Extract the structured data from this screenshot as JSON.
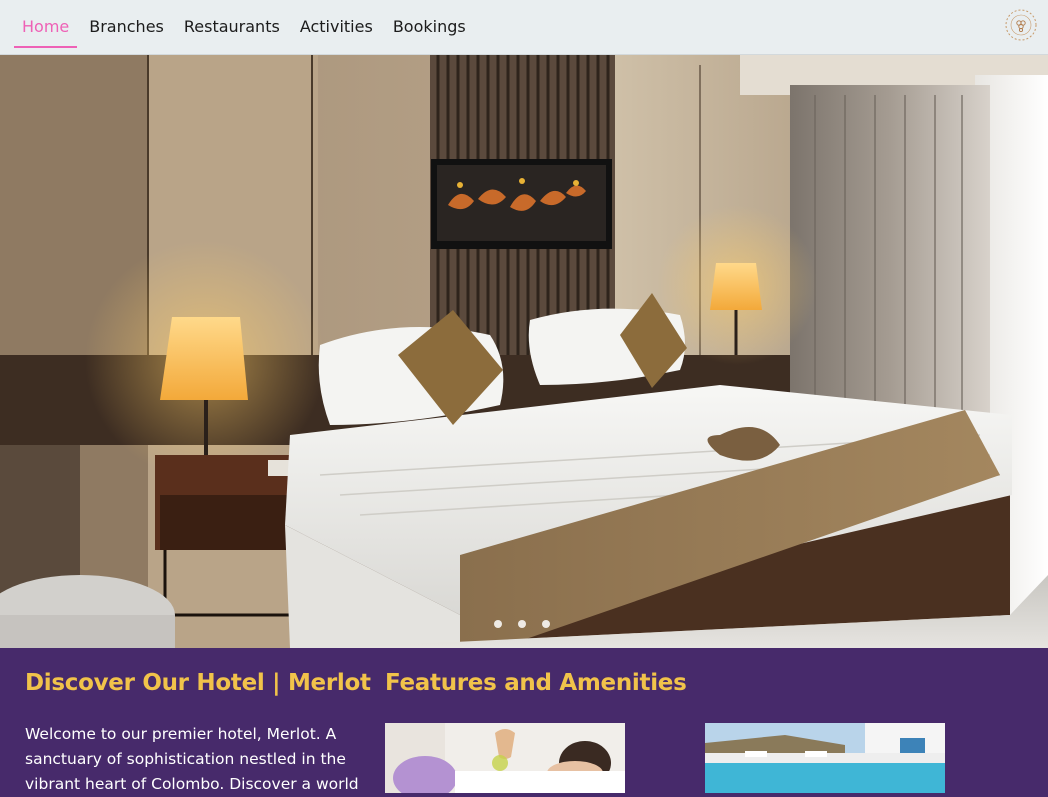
{
  "nav": {
    "items": [
      {
        "label": "Home",
        "active": true
      },
      {
        "label": "Branches",
        "active": false
      },
      {
        "label": "Restaurants",
        "active": false
      },
      {
        "label": "Activities",
        "active": false
      },
      {
        "label": "Bookings",
        "active": false
      }
    ],
    "logo_icon": "merlot-logo-icon"
  },
  "hero": {
    "image": "hotel-bedroom-photo",
    "slides": 3,
    "active_slide": 1
  },
  "about": {
    "title": "Discover Our Hotel | Merlot",
    "text": "Welcome to our premier hotel, Merlot. A sanctuary of sophistication nestled in the vibrant heart of Colombo. Discover a world"
  },
  "features": {
    "title": "Features and Amenities",
    "cards": [
      {
        "image": "spa-massage-photo"
      },
      {
        "image": "pool-photo"
      }
    ]
  },
  "colors": {
    "accent_pink": "#ee61b6",
    "heading_gold": "#f1c34a",
    "section_purple": "#472a6b",
    "topbar_bg": "#e9eef0"
  }
}
